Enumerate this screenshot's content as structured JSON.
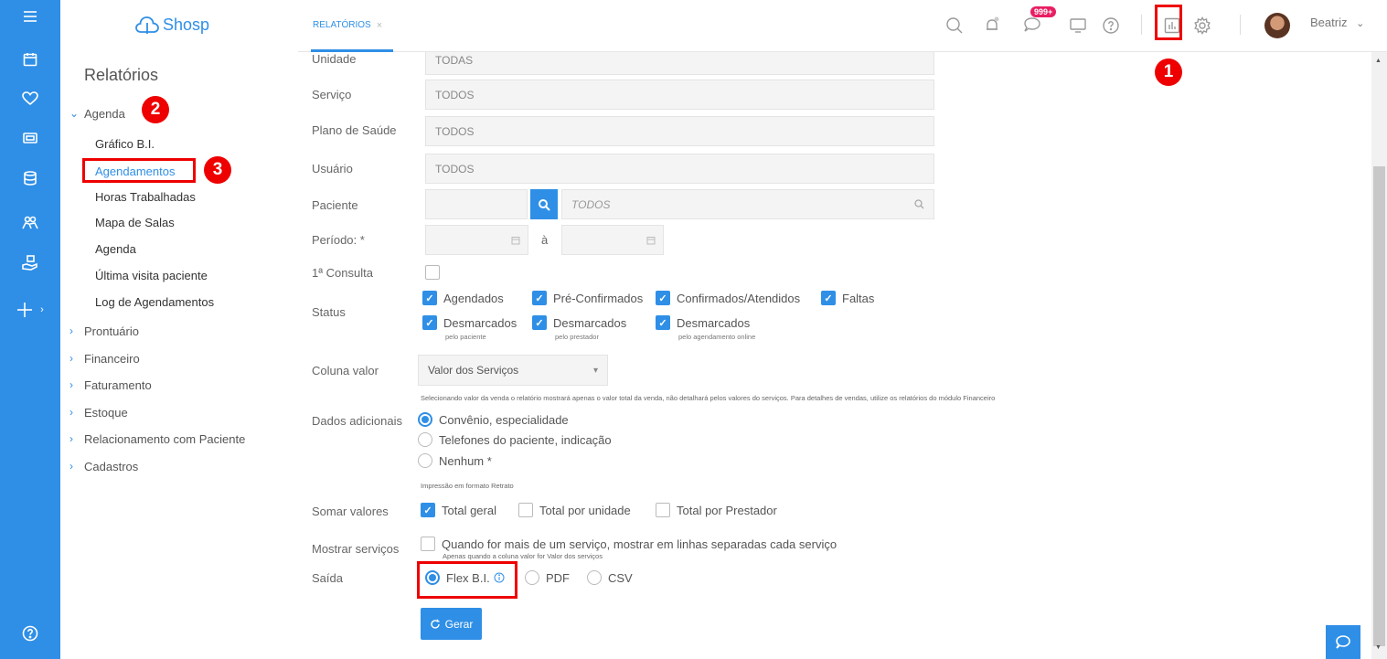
{
  "app": {
    "logo_text": "Shosp",
    "brand_color": "#2f8fe6"
  },
  "rail": {
    "items": [
      {
        "icon": "menu-icon"
      },
      {
        "icon": "calendar-icon"
      },
      {
        "icon": "heart-icon"
      },
      {
        "icon": "money-icon"
      },
      {
        "icon": "database-icon"
      },
      {
        "icon": "people-icon"
      },
      {
        "icon": "hand-box-icon"
      },
      {
        "icon": "plus-icon",
        "label": "+ ›"
      }
    ],
    "help_icon": "help-icon"
  },
  "nav": {
    "title": "Relatórios",
    "sections": [
      {
        "label": "Agenda",
        "expanded": true
      },
      {
        "label": "Prontuário"
      },
      {
        "label": "Financeiro"
      },
      {
        "label": "Faturamento"
      },
      {
        "label": "Estoque"
      },
      {
        "label": "Relacionamento com Paciente"
      },
      {
        "label": "Cadastros"
      }
    ],
    "agenda_items": [
      {
        "label": "Gráfico B.I."
      },
      {
        "label": "Agendamentos",
        "active": true
      },
      {
        "label": "Horas Trabalhadas"
      },
      {
        "label": "Mapa de Salas"
      },
      {
        "label": "Agenda"
      },
      {
        "label": "Última visita paciente"
      },
      {
        "label": "Log de Agendamentos"
      }
    ]
  },
  "annotations": {
    "one": "1",
    "two": "2",
    "three": "3"
  },
  "topbar": {
    "tab_label": "RELATÓRIOS",
    "tab_close": "×",
    "notif_badge": "999+",
    "user_name": "Beatriz",
    "user_caret": "⌄"
  },
  "form": {
    "unidade": {
      "label": "Unidade",
      "value": "TODAS"
    },
    "servico": {
      "label": "Serviço",
      "value": "TODOS"
    },
    "plano": {
      "label": "Plano de Saúde",
      "value": "TODOS"
    },
    "usuario": {
      "label": "Usuário",
      "value": "TODOS"
    },
    "paciente": {
      "label": "Paciente",
      "placeholder": "TODOS"
    },
    "periodo": {
      "label": "Período: *",
      "sep": "à"
    },
    "primeira": {
      "label": "1ª Consulta"
    },
    "status": {
      "label": "Status",
      "options": [
        {
          "label": "Agendados",
          "checked": true
        },
        {
          "label": "Pré-Confirmados",
          "checked": true
        },
        {
          "label": "Confirmados/Atendidos",
          "checked": true
        },
        {
          "label": "Faltas",
          "checked": true
        },
        {
          "label": "Desmarcados",
          "sub": "pelo paciente",
          "checked": true
        },
        {
          "label": "Desmarcados",
          "sub": "pelo prestador",
          "checked": true
        },
        {
          "label": "Desmarcados",
          "sub": "pelo agendamento online",
          "checked": true
        }
      ]
    },
    "coluna": {
      "label": "Coluna valor",
      "value": "Valor dos Serviços",
      "caret": "▾",
      "hint": "Selecionando valor da venda o relatório mostrará apenas o valor total da venda, não detalhará pelos valores do serviços. Para detalhes de vendas, utilize os relatórios do módulo Financeiro"
    },
    "dados": {
      "label": "Dados adicionais",
      "options": [
        {
          "label": "Convênio, especialidade",
          "checked": true
        },
        {
          "label": "Telefones do paciente, indicação",
          "checked": false
        },
        {
          "label": "Nenhum *",
          "checked": false
        }
      ],
      "hint": "Impressão em formato Retrato"
    },
    "somar": {
      "label": "Somar valores",
      "options": [
        {
          "label": "Total geral",
          "checked": true
        },
        {
          "label": "Total por unidade",
          "checked": false
        },
        {
          "label": "Total por Prestador",
          "checked": false
        }
      ]
    },
    "mostrar": {
      "label": "Mostrar serviços",
      "option": "Quando for mais de um serviço, mostrar em linhas separadas cada serviço",
      "hint": "Apenas quando a coluna valor for Valor dos serviços"
    },
    "saida": {
      "label": "Saída",
      "options": [
        {
          "label": "Flex B.I.",
          "checked": true
        },
        {
          "label": "PDF",
          "checked": false
        },
        {
          "label": "CSV",
          "checked": false
        }
      ]
    },
    "gerar_label": "Gerar"
  }
}
